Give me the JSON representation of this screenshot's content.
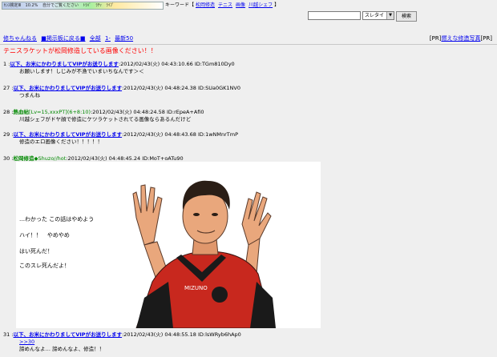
{
  "topbar": {
    "meter_segments": [
      "ｾﾝｽ検定Ⅲ",
      "10.2%",
      "自分でご覧ください",
      "ﾄﾗﾊﾞ",
      "ﾗﾁｯ",
      "ﾗｲﾌﾞ"
    ],
    "keyword_label": "キーワード【",
    "keywords": [
      "松岡修造",
      "テニス",
      "画像",
      "川越シェフ"
    ],
    "keyword_close": "】"
  },
  "search": {
    "value": "",
    "select_value": "スレタイ",
    "button_label": "検索"
  },
  "nav": {
    "items": [
      "修ちゃんねる",
      "■掲示板に戻る■",
      "全部",
      "1-",
      "最新50"
    ],
    "pr_prefix": "[PR]",
    "pr_link": "燃えな修造写真",
    "pr_suffix": "[PR]"
  },
  "thread_title": "テニスラケットが松岡修造している画像ください！！",
  "posts": [
    {
      "num": "1",
      "name": "以下、お米にかわりましてVIPがお送りします",
      "meta": ":2012/02/43(火) 04:43:10.66 ID:TGm810Dy0",
      "lines": [
        "お願いします！しじみが不漁でいまいちなんです＞＜"
      ]
    },
    {
      "num": "27",
      "name": "以下、お米にかわりましてVIPがお送りします",
      "meta": ":2012/02/43(火) 04:48:24.38 ID:SUa0GK1NV0",
      "lines": [
        "つまんね"
      ]
    },
    {
      "num": "28",
      "name": "熱血帖",
      "trip": "[Lv=15,xxxPT]",
      "trip2": "(6+8:10)",
      "meta": ":2012/02/43(火) 04:48:24.58 ID:rEpeA+Afi0",
      "lines": [
        "川越シェフがドヤ顔で修造にケツラケットされてる画像ならあるんだけど"
      ]
    },
    {
      "num": "29",
      "name": "以下、お米にかわりましてVIPがお送りします",
      "meta": ":2012/02/43(火) 04:48:43.68 ID:1wNMnrTmP",
      "lines": [
        "修造のエロ画像ください！！！！！"
      ]
    },
    {
      "num": "30",
      "name": "松岡修造",
      "trip": "◆Shuzo//hot",
      "meta": ":2012/02/43(火) 04:48:45.24 ID:MoT+oATu90",
      "lines": []
    },
    {
      "num": "31",
      "name": "以下、お米にかわりましてVIPがお送りします",
      "meta": ":2012/02/43(火) 04:48:55.18 ID:lsWRyb6hAp0",
      "lines": [
        ">>30",
        "諦めんなよ… 諦めんなよ、修造！！"
      ]
    }
  ],
  "quote_lines": [
    "…わかった この話はやめよう",
    "ハイ！！　やめやめ",
    "はい死んだ！",
    "このスレ死んだよ！"
  ],
  "image_text": "MIZUNO",
  "colors": {
    "bg": "#efefef",
    "link": "#0000ee",
    "name": "#008800",
    "title": "#ff0000",
    "shirt": "#c8281e"
  }
}
